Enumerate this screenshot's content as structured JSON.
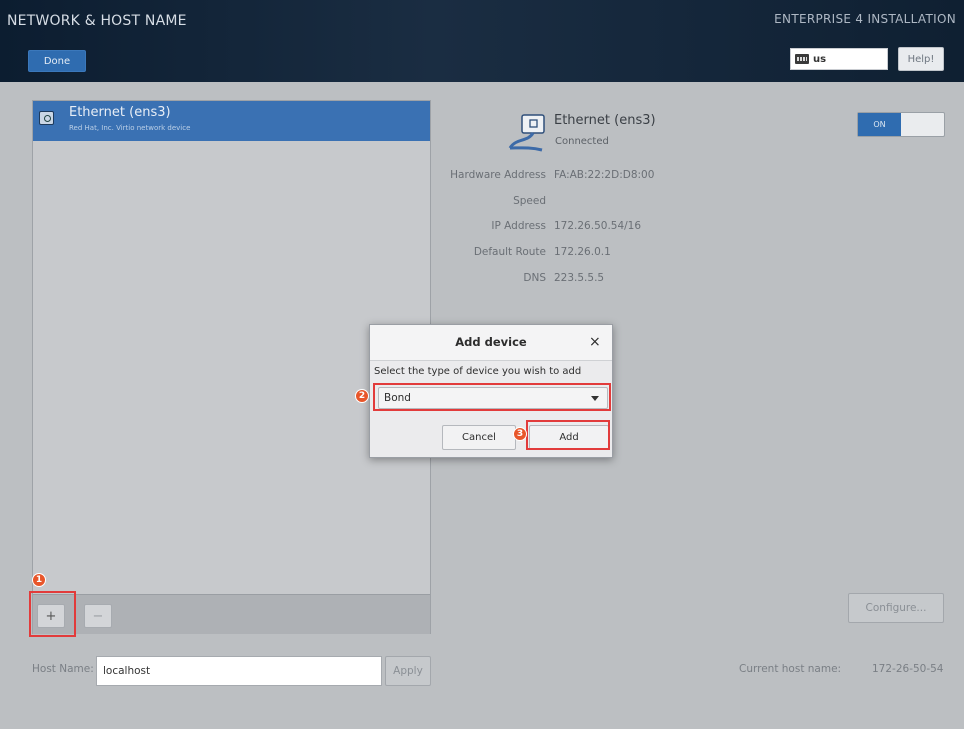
{
  "header": {
    "title": "NETWORK & HOST NAME",
    "done_label": "Done",
    "install_title": "ENTERPRISE 4 INSTALLATION",
    "keyboard_layout": "us",
    "help_label": "Help!"
  },
  "device_list": {
    "items": [
      {
        "name": "Ethernet (ens3)",
        "description": "Red Hat, Inc. Virtio network device"
      }
    ],
    "add_label": "+",
    "remove_label": "−"
  },
  "device_details": {
    "name": "Ethernet (ens3)",
    "status": "Connected",
    "toggle_label": "ON",
    "fields": [
      {
        "label": "Hardware Address",
        "value": "FA:AB:22:2D:D8:00"
      },
      {
        "label": "Speed",
        "value": ""
      },
      {
        "label": "IP Address",
        "value": "172.26.50.54/16"
      },
      {
        "label": "Default Route",
        "value": "172.26.0.1"
      },
      {
        "label": "DNS",
        "value": "223.5.5.5"
      }
    ],
    "configure_label": "Configure..."
  },
  "host": {
    "label": "Host Name:",
    "value": "localhost",
    "apply_label": "Apply",
    "current_label": "Current host name:",
    "current_value": "172-26-50-54"
  },
  "dialog": {
    "title": "Add device",
    "close_glyph": "×",
    "prompt": "Select the type of device you wish to add",
    "selected_type": "Bond",
    "cancel_label": "Cancel",
    "add_label": "Add"
  },
  "annotations": {
    "badges": [
      "1",
      "2",
      "3"
    ],
    "highlight_color": "#e23b3b",
    "badge_color": "#e8562a"
  },
  "colors": {
    "header_bg": "#15273b",
    "accent": "#2f6cb0",
    "selection": "#3a71b3"
  }
}
